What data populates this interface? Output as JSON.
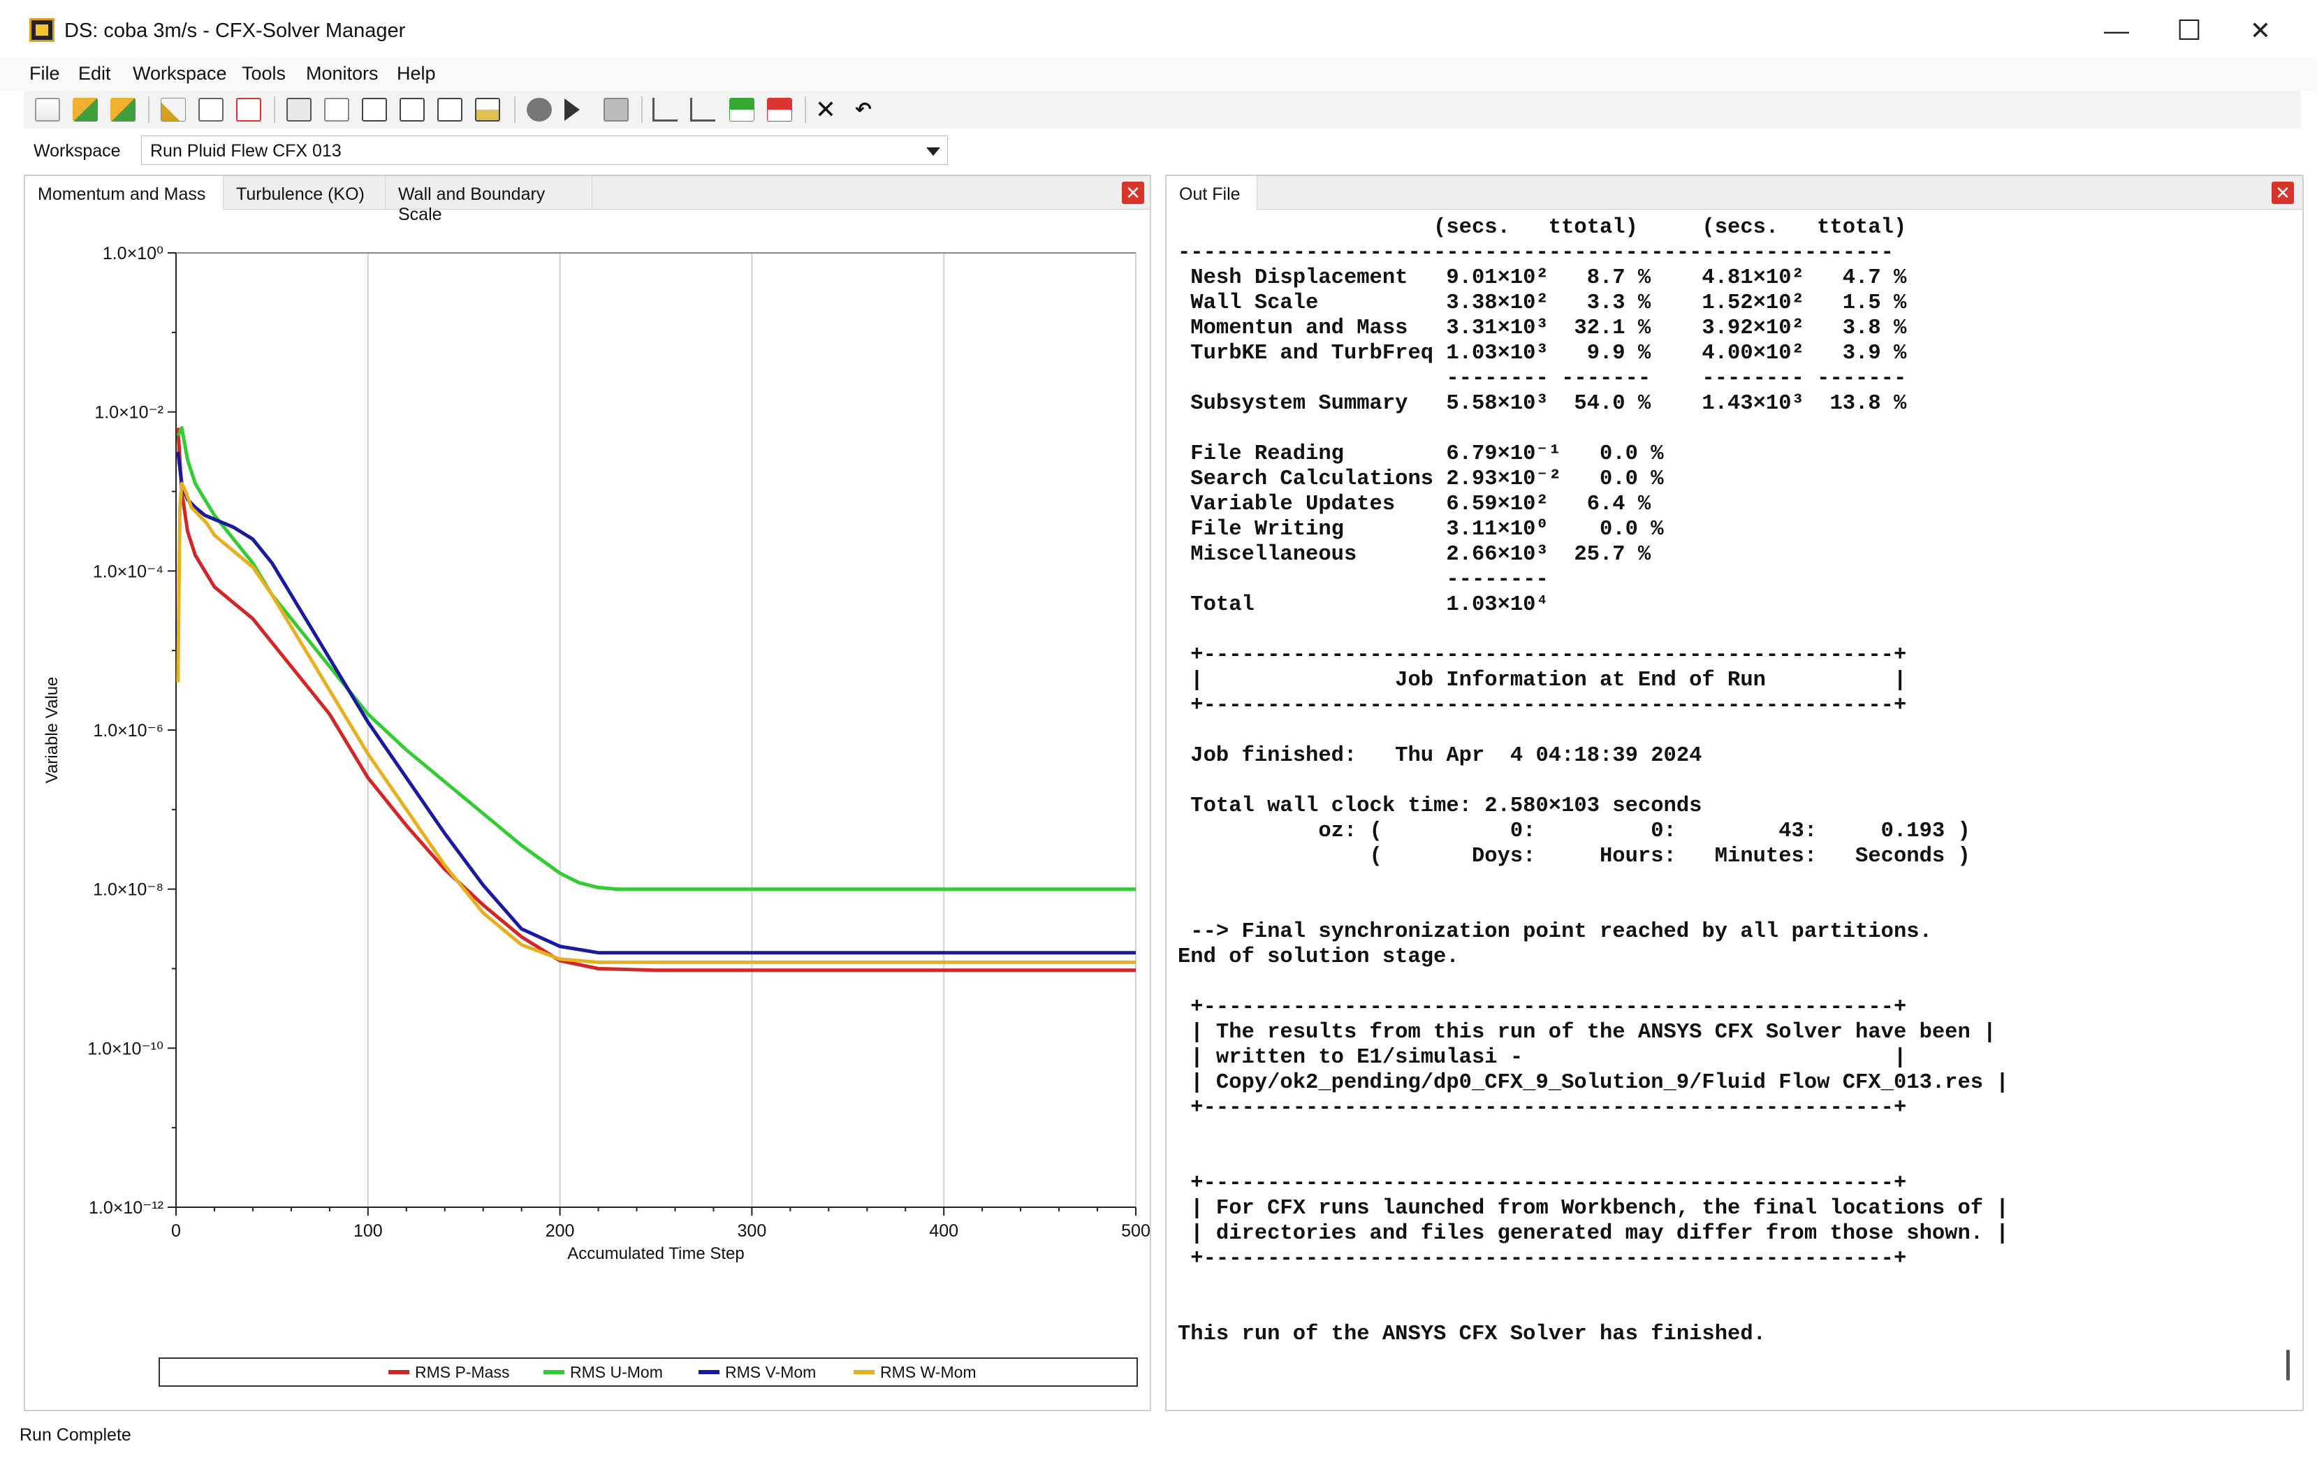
{
  "window": {
    "title": "DS: coba 3m/s - CFX-Solver Manager",
    "minimize_glyph": "—",
    "maximize_glyph": "☐",
    "close_glyph": "✕"
  },
  "menu": [
    "File",
    "Edit",
    "Workspace",
    "Tools",
    "Monitors",
    "Help"
  ],
  "workspace": {
    "label": "Workspace",
    "selected": "Run Pluid Flew CFX 013"
  },
  "left_panel": {
    "tabs": [
      "Momentum and Mass",
      "Turbulence (KO)",
      "Wall and Boundary Scale"
    ],
    "active_tab": 0,
    "close_glyph": "✕"
  },
  "right_panel": {
    "tabs": [
      "Out File"
    ],
    "close_glyph": "✕",
    "lines": [
      "                    (secs.   ttotal)     (secs.   ttotal)",
      "--------------------------------------------------------",
      " Nesh Displacement   9.01×10²   8.7 %    4.81×10²   4.7 %",
      " Wall Scale          3.38×10²   3.3 %    1.52×10²   1.5 %",
      " Momentun and Mass   3.31×10³  32.1 %    3.92×10²   3.8 %",
      " TurbKE and TurbFreq 1.03×10³   9.9 %    4.00×10²   3.9 %",
      "                     -------- -------    -------- -------",
      " Subsystem Summary   5.58×10³  54.0 %    1.43×10³  13.8 %",
      "",
      " File Reading        6.79×10⁻¹   0.0 %",
      " Search Calculations 2.93×10⁻²   0.0 %",
      " Variable Updates    6.59×10²   6.4 %",
      " File Writing        3.11×10⁰    0.0 %",
      " Miscellaneous       2.66×10³  25.7 %",
      "                     --------",
      " Total               1.03×10⁴",
      "",
      " +------------------------------------------------------+",
      " |               Job Information at End of Run          |",
      " +------------------------------------------------------+",
      "",
      " Job finished:   Thu Apr  4 04:18:39 2024",
      "",
      " Total wall clock time: 2.580×103 seconds",
      "           oz: (          0:         0:        43:     0.193 )",
      "               (       Doys:     Hours:   Minutes:   Seconds )",
      "",
      "",
      " --> Final synchronization point reached by all partitions.",
      "End of solution stage.",
      "",
      " +------------------------------------------------------+",
      " | The results from this run of the ANSYS CFX Solver have been |",
      " | written to E1/simulasi -                             |",
      " | Copy/ok2_pending/dp0_CFX_9_Solution_9/Fluid Flow CFX_013.res |",
      " +------------------------------------------------------+",
      "",
      "",
      " +------------------------------------------------------+",
      " | For CFX runs launched from Workbench, the final locations of |",
      " | directories and files generated may differ from those shown. |",
      " +------------------------------------------------------+",
      "",
      "",
      "This run of the ANSYS CFX Solver has finished."
    ]
  },
  "status": {
    "text": "Run Complete"
  },
  "chart_data": {
    "type": "line",
    "title": "",
    "xlabel": "Accumulated Time Step",
    "ylabel": "Variable Value",
    "xlim": [
      0,
      500
    ],
    "ylim": [
      1e-12,
      1
    ],
    "yscale": "log",
    "grid": true,
    "legend_position": "bottom",
    "x_ticks": [
      0,
      100,
      200,
      300,
      400,
      500
    ],
    "y_ticks": [
      "1.0×10⁰",
      "1.0×10⁻²",
      "1.0×10⁻⁴",
      "1.0×10⁻⁶",
      "1.0×10⁻⁸",
      "1.0×10⁻¹⁰",
      "1.0×10⁻¹²"
    ],
    "y_tick_exponents": [
      0,
      -2,
      -4,
      -6,
      -8,
      -10,
      -12
    ],
    "series": [
      {
        "name": "RMS P-Mass",
        "color": "#d32626",
        "x": [
          1,
          3,
          6,
          10,
          15,
          20,
          30,
          40,
          50,
          60,
          70,
          80,
          90,
          100,
          120,
          140,
          160,
          180,
          200,
          220,
          250,
          300,
          350,
          400,
          450,
          500
        ],
        "log10y": [
          -2.2,
          -3.0,
          -3.5,
          -3.8,
          -4.0,
          -4.2,
          -4.4,
          -4.6,
          -4.9,
          -5.2,
          -5.5,
          -5.8,
          -6.2,
          -6.6,
          -7.2,
          -7.75,
          -8.2,
          -8.6,
          -8.9,
          -9.0,
          -9.02,
          -9.02,
          -9.02,
          -9.02,
          -9.02,
          -9.02
        ]
      },
      {
        "name": "RMS U-Mom",
        "color": "#33cc33",
        "x": [
          1,
          3,
          6,
          10,
          15,
          20,
          30,
          40,
          50,
          60,
          70,
          80,
          90,
          100,
          120,
          140,
          160,
          180,
          200,
          210,
          220,
          230,
          250,
          300,
          350,
          400,
          450,
          500
        ],
        "log10y": [
          -2.3,
          -2.2,
          -2.6,
          -2.9,
          -3.1,
          -3.3,
          -3.6,
          -3.9,
          -4.3,
          -4.6,
          -4.9,
          -5.2,
          -5.5,
          -5.8,
          -6.25,
          -6.65,
          -7.05,
          -7.45,
          -7.8,
          -7.92,
          -7.98,
          -8.0,
          -8.0,
          -8.0,
          -8.0,
          -8.0,
          -8.0,
          -8.0
        ]
      },
      {
        "name": "RMS V-Mom",
        "color": "#1a1aa0",
        "x": [
          1,
          3,
          6,
          10,
          15,
          20,
          30,
          40,
          50,
          60,
          70,
          80,
          90,
          100,
          120,
          140,
          160,
          180,
          200,
          220,
          250,
          300,
          350,
          400,
          450,
          500
        ],
        "log10y": [
          -2.5,
          -2.9,
          -3.1,
          -3.2,
          -3.3,
          -3.35,
          -3.45,
          -3.6,
          -3.9,
          -4.3,
          -4.7,
          -5.1,
          -5.5,
          -5.9,
          -6.6,
          -7.3,
          -7.95,
          -8.5,
          -8.72,
          -8.8,
          -8.8,
          -8.8,
          -8.8,
          -8.8,
          -8.8,
          -8.8
        ]
      },
      {
        "name": "RMS W-Mom",
        "color": "#e6b020",
        "x": [
          1,
          2,
          3,
          5,
          8,
          12,
          16,
          20,
          30,
          40,
          50,
          60,
          70,
          80,
          90,
          100,
          120,
          140,
          160,
          180,
          200,
          220,
          250,
          300,
          350,
          400,
          450,
          500
        ],
        "log10y": [
          -5.4,
          -3.2,
          -2.9,
          -3.0,
          -3.2,
          -3.3,
          -3.4,
          -3.55,
          -3.75,
          -3.95,
          -4.3,
          -4.7,
          -5.1,
          -5.5,
          -5.9,
          -6.3,
          -7.0,
          -7.7,
          -8.3,
          -8.7,
          -8.88,
          -8.92,
          -8.92,
          -8.92,
          -8.92,
          -8.92,
          -8.92,
          -8.92
        ]
      }
    ]
  }
}
